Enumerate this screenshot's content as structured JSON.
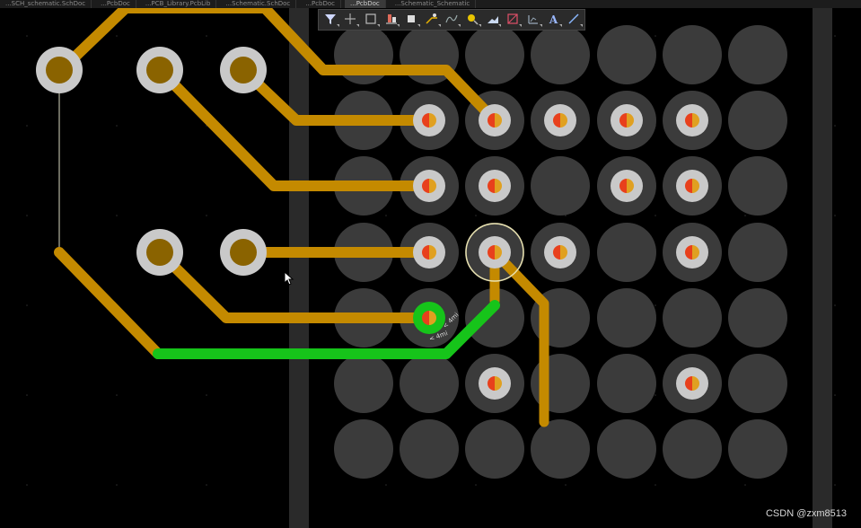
{
  "tabs": [
    {
      "label": "...SCH_schematic.SchDoc",
      "active": false
    },
    {
      "label": "...PcbDoc",
      "active": false
    },
    {
      "label": "...PCB_Library.PcbLib",
      "active": false
    },
    {
      "label": "...Schematic.SchDoc",
      "active": false
    },
    {
      "label": "...PcbDoc",
      "active": false
    },
    {
      "label": "...PcbDoc",
      "active": true
    },
    {
      "label": "...Schematic_Schematic",
      "active": false
    }
  ],
  "toolbar": {
    "tools": [
      {
        "name": "filter-tool",
        "icon": "filter-icon"
      },
      {
        "name": "route-tool",
        "icon": "crosshair-icon"
      },
      {
        "name": "select-tool",
        "icon": "rectangle-select-icon"
      },
      {
        "name": "align-tool",
        "icon": "align-icon"
      },
      {
        "name": "component-tool",
        "icon": "component-icon"
      },
      {
        "name": "interactive-route-tool",
        "icon": "route-icon"
      },
      {
        "name": "diff-pair-tool",
        "icon": "diff-pair-icon"
      },
      {
        "name": "via-tool",
        "icon": "via-icon"
      },
      {
        "name": "fill-tool",
        "icon": "fill-icon"
      },
      {
        "name": "keepout-tool",
        "icon": "keepout-icon"
      },
      {
        "name": "dimension-tool",
        "icon": "dimension-icon"
      },
      {
        "name": "string-tool",
        "icon": "text-icon",
        "glyph": "A"
      },
      {
        "name": "line-tool",
        "icon": "line-icon"
      }
    ]
  },
  "annotation": {
    "dim_a": "< 4mi",
    "dim_b": "< 4mi"
  },
  "colors": {
    "track": "#c48a00",
    "active_track": "#16c41a",
    "pad_ring": "#c9c9c9",
    "pad_hole": "#8a6300",
    "bga_pad": "#3b3b3b",
    "background": "#000000"
  },
  "watermark": "CSDN @zxm8513"
}
